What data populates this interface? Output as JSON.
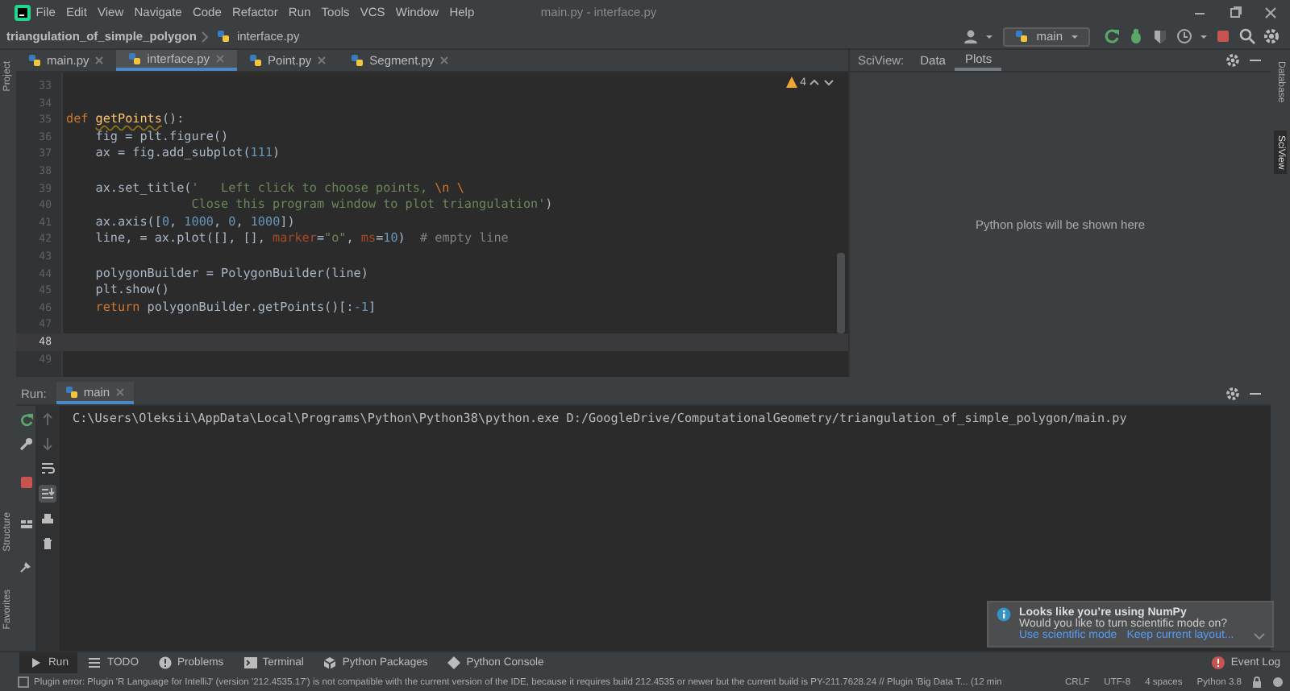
{
  "menu_bar": {
    "items": [
      "File",
      "Edit",
      "View",
      "Navigate",
      "Code",
      "Refactor",
      "Run",
      "Tools",
      "VCS",
      "Window",
      "Help"
    ],
    "window_title": "main.py - interface.py"
  },
  "navigation_bar": {
    "project": "triangulation_of_simple_polygon",
    "file": "interface.py",
    "run_configuration": "main"
  },
  "left_tool_strip": {
    "top": [
      "Project"
    ],
    "bottom": [
      "Structure",
      "Favorites"
    ]
  },
  "right_tool_strip": [
    {
      "label": "Database",
      "selected": false
    },
    {
      "label": "SciView",
      "selected": true
    }
  ],
  "editor": {
    "tabs": [
      {
        "label": "main.py",
        "selected": false
      },
      {
        "label": "interface.py",
        "selected": true
      },
      {
        "label": "Point.py",
        "selected": false
      },
      {
        "label": "Segment.py",
        "selected": false
      }
    ],
    "inspection_count": "4",
    "lines": [
      {
        "number": "33",
        "current": false
      },
      {
        "number": "34",
        "current": false
      },
      {
        "number": "35",
        "current": false,
        "tokens": [
          {
            "kind": "keyword",
            "text": "def "
          },
          {
            "kind": "function",
            "text": "getPoints"
          },
          {
            "kind": "plain",
            "text": "():"
          }
        ]
      },
      {
        "number": "36",
        "current": false,
        "tokens": [
          {
            "kind": "plain",
            "text": "    fig = plt.figure()"
          }
        ]
      },
      {
        "number": "37",
        "current": false,
        "tokens": [
          {
            "kind": "plain",
            "text": "    ax = fig.add_subplot("
          },
          {
            "kind": "number",
            "text": "111"
          },
          {
            "kind": "plain",
            "text": ")"
          }
        ]
      },
      {
        "number": "38",
        "current": false
      },
      {
        "number": "39",
        "current": false,
        "tokens": [
          {
            "kind": "plain",
            "text": "    ax.set_title("
          },
          {
            "kind": "string",
            "text": "'   Left click to choose points, "
          },
          {
            "kind": "escape",
            "text": "\\n \\"
          }
        ]
      },
      {
        "number": "40",
        "current": false,
        "tokens": [
          {
            "kind": "string",
            "text": "                 Close this program window to plot triangulation'"
          },
          {
            "kind": "plain",
            "text": ")"
          }
        ]
      },
      {
        "number": "41",
        "current": false,
        "tokens": [
          {
            "kind": "plain",
            "text": "    ax.axis(["
          },
          {
            "kind": "number",
            "text": "0"
          },
          {
            "kind": "plain",
            "text": ", "
          },
          {
            "kind": "number",
            "text": "1000"
          },
          {
            "kind": "plain",
            "text": ", "
          },
          {
            "kind": "number",
            "text": "0"
          },
          {
            "kind": "plain",
            "text": ", "
          },
          {
            "kind": "number",
            "text": "1000"
          },
          {
            "kind": "plain",
            "text": "])"
          }
        ]
      },
      {
        "number": "42",
        "current": false,
        "tokens": [
          {
            "kind": "plain",
            "text": "    line, = ax.plot([], [], "
          },
          {
            "kind": "parameter",
            "text": "marker"
          },
          {
            "kind": "plain",
            "text": "="
          },
          {
            "kind": "string",
            "text": "\"o\""
          },
          {
            "kind": "plain",
            "text": ", "
          },
          {
            "kind": "parameter",
            "text": "ms"
          },
          {
            "kind": "plain",
            "text": "="
          },
          {
            "kind": "number",
            "text": "10"
          },
          {
            "kind": "plain",
            "text": ")  "
          },
          {
            "kind": "comment",
            "text": "# empty line"
          }
        ]
      },
      {
        "number": "43",
        "current": false
      },
      {
        "number": "44",
        "current": false,
        "tokens": [
          {
            "kind": "plain",
            "text": "    polygonBuilder = PolygonBuilder(line)"
          }
        ]
      },
      {
        "number": "45",
        "current": false,
        "tokens": [
          {
            "kind": "plain",
            "text": "    plt.show()"
          }
        ]
      },
      {
        "number": "46",
        "current": false,
        "tokens": [
          {
            "kind": "keyword",
            "text": "    return "
          },
          {
            "kind": "plain",
            "text": "polygonBuilder.getPoints()[:"
          },
          {
            "kind": "number",
            "text": "-1"
          },
          {
            "kind": "plain",
            "text": "]"
          }
        ]
      },
      {
        "number": "47",
        "current": false
      },
      {
        "number": "48",
        "current": true
      },
      {
        "number": "49",
        "current": false
      }
    ]
  },
  "sciview": {
    "label": "SciView:",
    "tabs": [
      {
        "label": "Data",
        "selected": false
      },
      {
        "label": "Plots",
        "selected": true
      }
    ],
    "message": "Python plots will be shown here"
  },
  "run_panel": {
    "label": "Run:",
    "tab": "main",
    "console_lines": [
      "C:\\Users\\Oleksii\\AppData\\Local\\Programs\\Python\\Python38\\python.exe D:/GoogleDrive/ComputationalGeometry/triangulation_of_simple_polygon/main.py"
    ]
  },
  "notification": {
    "title": "Looks like you’re using NumPy",
    "message": "Would you like to turn scientific mode on?",
    "links": [
      "Use scientific mode",
      "Keep current layout..."
    ]
  },
  "bottom_tabs": [
    {
      "kind": "run",
      "label": "Run",
      "selected": true
    },
    {
      "kind": "todo",
      "label": "TODO",
      "selected": false
    },
    {
      "kind": "problems",
      "label": "Problems",
      "selected": false
    },
    {
      "kind": "terminal",
      "label": "Terminal",
      "selected": false
    },
    {
      "kind": "packages",
      "label": "Python Packages",
      "selected": false
    },
    {
      "kind": "console",
      "label": "Python Console",
      "selected": false
    }
  ],
  "event_log": "Event Log",
  "status_bar": {
    "message": "Plugin error: Plugin 'R Language for IntelliJ' (version '212.4535.17') is not compatible with the current version of the IDE, because it requires build 212.4535 or newer but the current build is PY-211.7628.24 // Plugin 'Big Data T... (12 min",
    "items": [
      "CRLF",
      "UTF-8",
      "4 spaces",
      "Python 3.8"
    ]
  }
}
